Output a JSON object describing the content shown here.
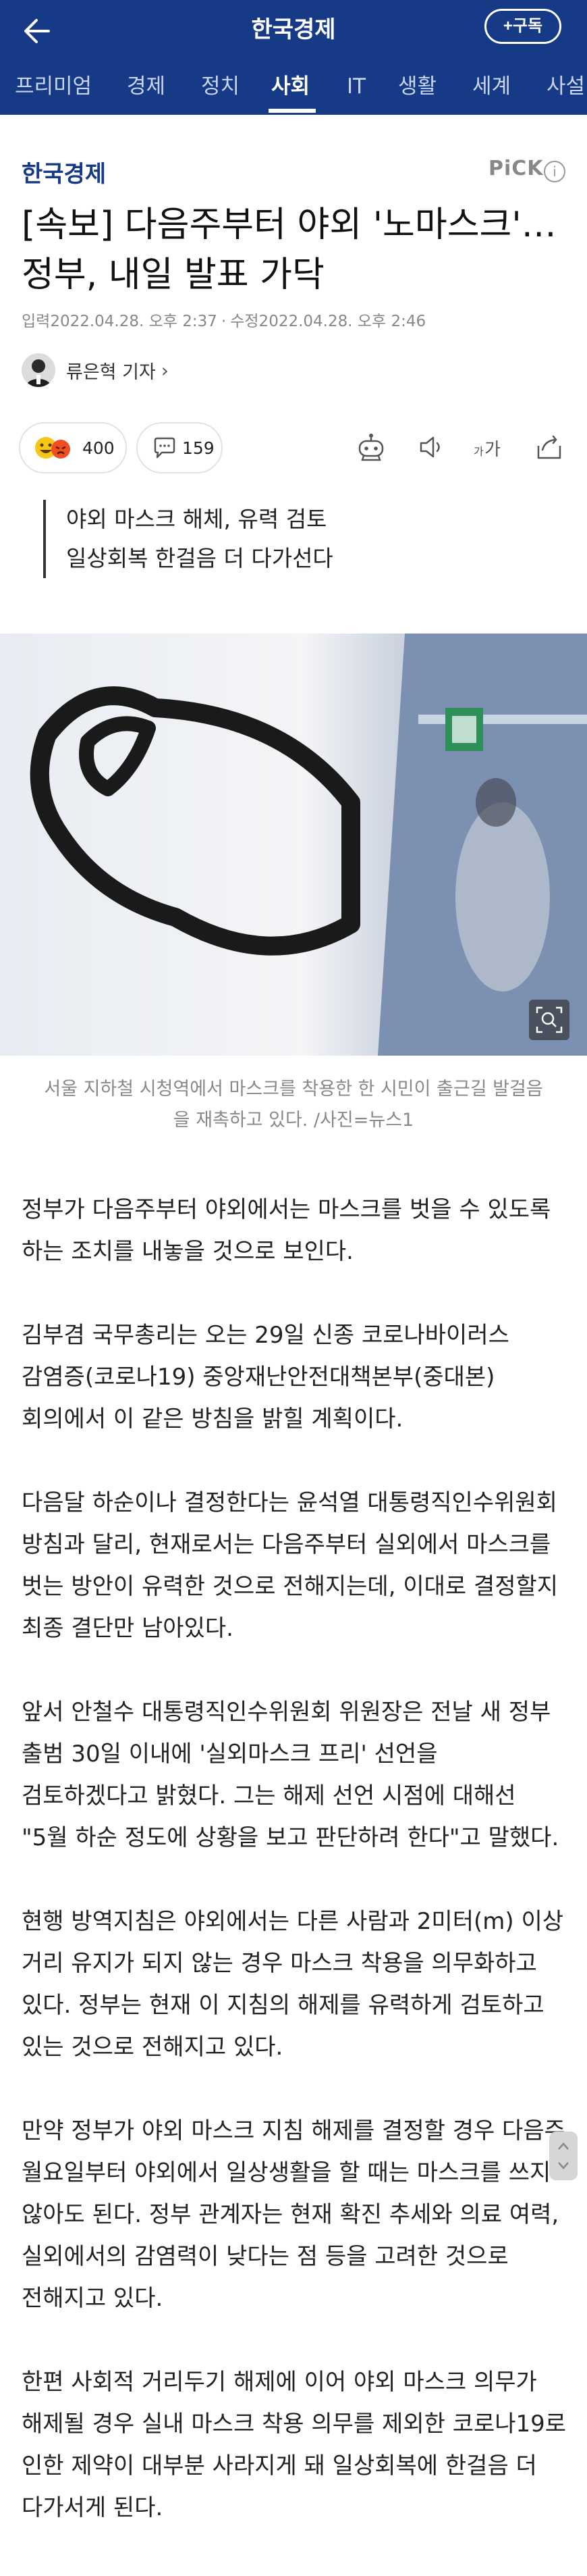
{
  "header": {
    "title": "한국경제",
    "subscribe_label": "+구독"
  },
  "categories": [
    {
      "label": "프리미엄"
    },
    {
      "label": "경제"
    },
    {
      "label": "정치"
    },
    {
      "label": "사회",
      "active": true
    },
    {
      "label": "IT"
    },
    {
      "label": "생활"
    },
    {
      "label": "세계"
    },
    {
      "label": "사설"
    }
  ],
  "article": {
    "brand": "한국경제",
    "pick": "PiCK",
    "headline": "[속보] 다음주부터 야외 '노마스크'… 정부, 내일 발표 가닥",
    "published": "입력2022.04.28. 오후 2:37",
    "modified": "수정2022.04.28. 오후 2:46",
    "author": "류은혁 기자",
    "reactions": {
      "emoji_count": "400",
      "comment_count": "159"
    },
    "summary": [
      "야외 마스크 해체, 유력 검토",
      "일상회복 한걸음 더 다가선다"
    ],
    "image_caption": "서울 지하철 시청역에서 마스크를 착용한 한 시민이 출근길 발걸음을 재촉하고 있다. /사진=뉴스1",
    "paragraphs": [
      "정부가 다음주부터 야외에서는 마스크를 벗을 수 있도록 하는 조치를 내놓을 것으로 보인다.",
      "김부겸 국무총리는 오는 29일 신종 코로나바이러스 감염증(코로나19) 중앙재난안전대책본부(중대본) 회의에서 이 같은 방침을 밝힐 계획이다.",
      "다음달 하순이나 결정한다는 윤석열 대통령직인수위원회 방침과 달리, 현재로서는 다음주부터 실외에서 마스크를 벗는 방안이 유력한 것으로 전해지는데, 이대로 결정할지 최종 결단만 남아있다.",
      "앞서 안철수 대통령직인수위원회 위원장은 전날 새 정부 출범 30일 이내에 '실외마스크 프리' 선언을 검토하겠다고 밝혔다. 그는 해제 선언 시점에 대해선 \"5월 하순 정도에 상황을 보고 판단하려 한다\"고 말했다.",
      "현행 방역지침은 야외에서는 다른 사람과 2미터(m) 이상 거리 유지가 되지 않는 경우 마스크 착용을 의무화하고 있다. 정부는 현재 이 지침의 해제를 유력하게 검토하고 있는 것으로 전해지고 있다.",
      "만약 정부가 야외 마스크 지침 해제를 결정할 경우 다음주 월요일부터 야외에서 일상생활을 할 때는 마스크를 쓰지 않아도 된다. 정부 관계자는 현재 확진 추세와 의료 여력, 실외에서의 감염력이 낮다는 점 등을 고려한 것으로 전해지고 있다.",
      "한편 사회적 거리두기 해제에 이어 야외 마스크 의무가 해제될 경우 실내 마스크 착용 의무를 제외한 코로나19로 인한 제약이 대부분 사라지게 돼 일상회복에 한걸음 더 다가서게 된다."
    ]
  },
  "icons": [
    "back-arrow-icon",
    "emoji-reaction-icon",
    "comment-icon",
    "robot-icon",
    "speaker-icon",
    "font-size-icon",
    "share-icon",
    "zoom-icon"
  ],
  "colors": {
    "brand_navy": "#173a87",
    "text": "#222222",
    "muted": "#888888"
  }
}
